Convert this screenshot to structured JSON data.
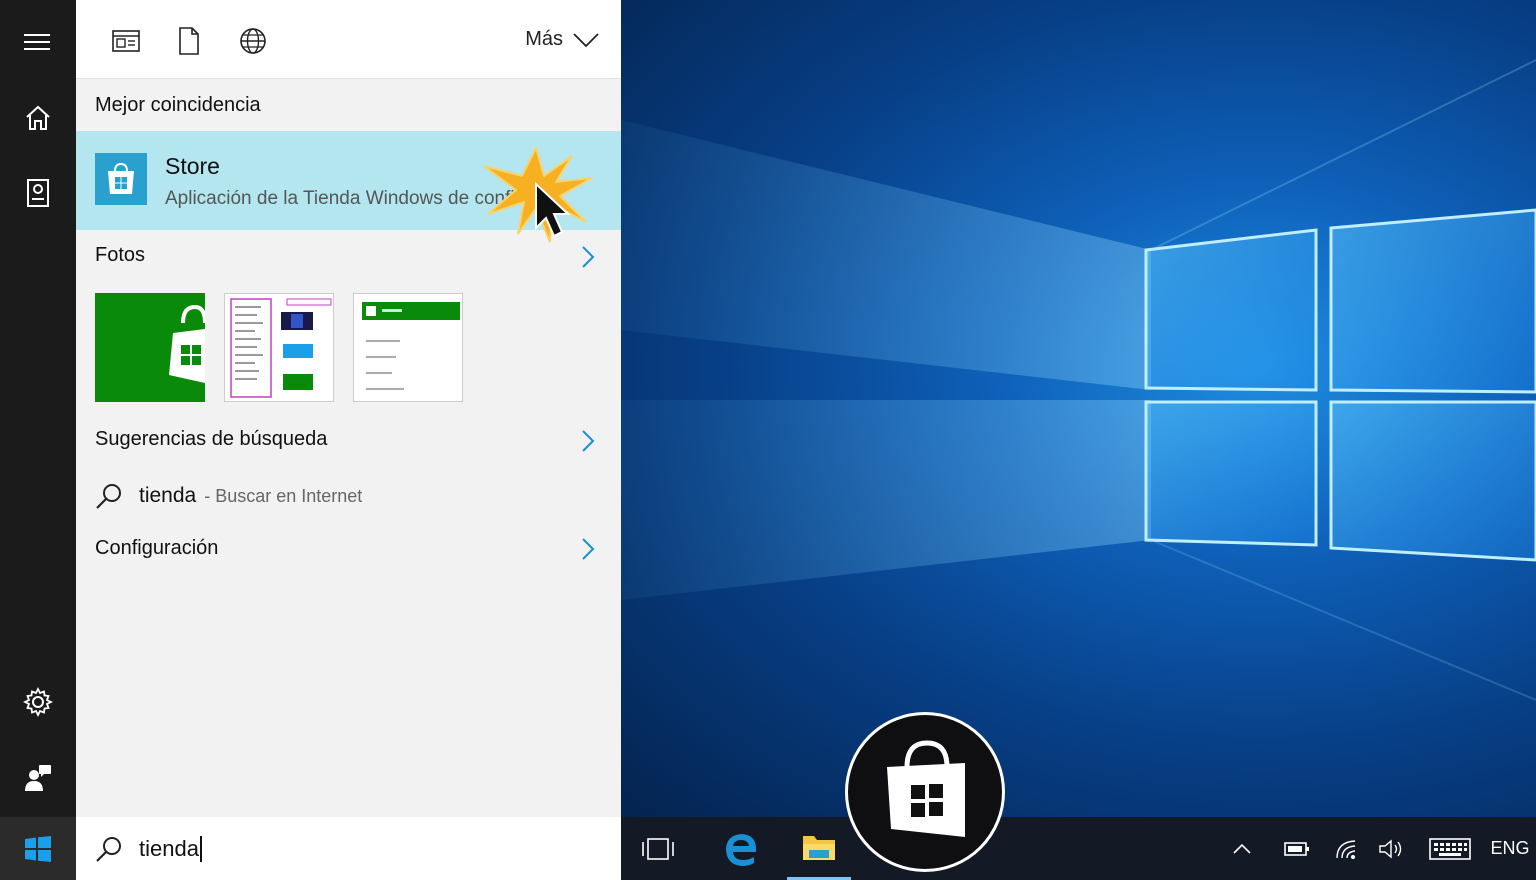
{
  "filters": {
    "apps_icon": "apps-filter-icon",
    "docs_icon": "documents-filter-icon",
    "web_icon": "web-filter-icon",
    "more_label": "Más"
  },
  "best_match": {
    "header": "Mejor coincidencia",
    "title": "Store",
    "subtitle": "Aplicación de la Tienda Windows de confianza"
  },
  "photos": {
    "header": "Fotos"
  },
  "suggestions": {
    "header": "Sugerencias de búsqueda",
    "term": "tienda",
    "hint": "- Buscar en Internet"
  },
  "settings": {
    "header": "Configuración"
  },
  "search": {
    "query": "tienda"
  },
  "taskbar": {
    "language": "ENG"
  },
  "colors": {
    "highlight": "#b3e6ee",
    "store_tile": "#2aa0cf",
    "accent_blue": "#1a8fd6",
    "store_green": "#0a8a0a"
  }
}
